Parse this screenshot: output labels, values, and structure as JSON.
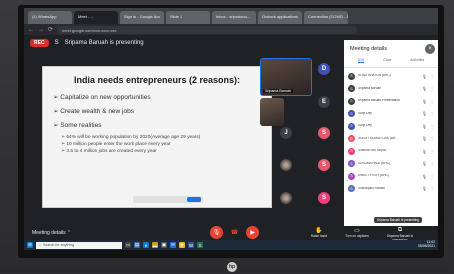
{
  "browser": {
    "tabs": [
      "(1) WhatsApp",
      "Meet - ...",
      "Sign in - Google Acc",
      "Slide 1",
      "Inbox - sripobanu...",
      "Outlook applications",
      "Connection [COVID - 19]"
    ],
    "url": "meet.google.com/xxx-xxxx-xxx"
  },
  "meet": {
    "rec_label": "REC",
    "presenter_initial": "S",
    "presenting_text": "Sripama Baruah is presenting",
    "self_label": "Sripama Baruah"
  },
  "slide": {
    "title": "India needs entrepreneurs (2 reasons):",
    "bullets": [
      "Capitalize on new opportunities",
      "Create wealth & new jobs",
      "Some realities"
    ],
    "sub_bullets": [
      "64% will be working population by 2020(Average age 29 years)",
      "10 million people enter the work place every year",
      "3.5 to 4 million jobs are created every year"
    ]
  },
  "tiles": [
    {
      "initial": "D",
      "color": "#3f51b5"
    },
    {
      "initial": "E",
      "color": "#3c4043"
    },
    {
      "initial": "J",
      "color": "#3c4043"
    },
    {
      "initial": "S",
      "color": "#e8556d"
    },
    {
      "initial": "S",
      "color": "#e8556d"
    },
    {
      "initial": "S",
      "color": "#ec407a"
    }
  ],
  "panel": {
    "title": "Meeting details",
    "close_icon": "×",
    "tabs": [
      "(14)",
      "Chat",
      "Activities"
    ],
    "participants": [
      {
        "initial": "S",
        "name": "SONU KHATUN (BHC)",
        "color": "#3c4043"
      },
      {
        "initial": "S",
        "name": "Sripama Baruah",
        "color": "#3c4043"
      },
      {
        "initial": "S",
        "name": "Sripama Baruah Presentation",
        "color": "#3c4043"
      },
      {
        "initial": "S",
        "name": "Surjit Dey",
        "color": "#3f51b5"
      },
      {
        "initial": "S",
        "name": "Surjit Dey",
        "color": "#3f51b5"
      },
      {
        "initial": "S",
        "name": "SURJIT KUMAR DAS (BH...",
        "color": "#e8556d"
      },
      {
        "initial": "S",
        "name": "Susmita Sen Gupta",
        "color": "#ec407a"
      },
      {
        "initial": "S",
        "name": "SUSUMA PAUL (BHC)",
        "color": "#7e57c2"
      },
      {
        "initial": "S",
        "name": "SWEETY ROY (BHC)",
        "color": "#ab47bc"
      },
      {
        "initial": "S",
        "name": "Sukhdipaul Raman",
        "color": "#5c6bc0"
      }
    ]
  },
  "tooltip": "Sripama Baruah is presenting",
  "bottom": {
    "details_label": "Meeting details",
    "raise_hand": "Raise hand",
    "turn_on_captions": "Turn on captions",
    "presenting": "Sripama Baruah is presenting"
  },
  "taskbar": {
    "search_placeholder": "Search for anything",
    "time": "11:02",
    "date": "05/05/2021"
  },
  "logo": "hp"
}
